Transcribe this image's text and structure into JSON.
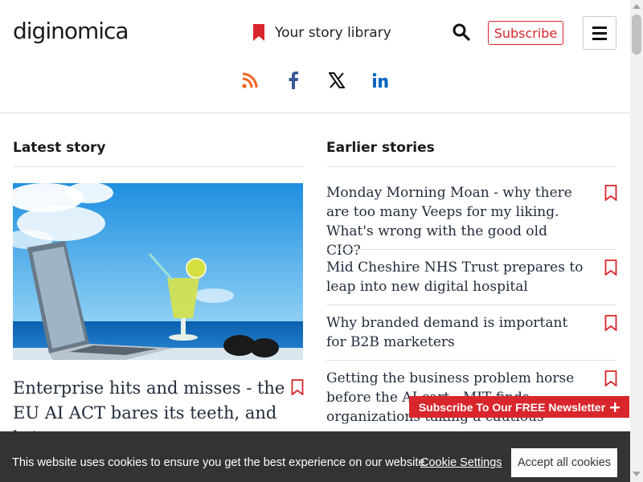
{
  "header": {
    "logo": "diginomica",
    "library_label": "Your story library",
    "subscribe_label": "Subscribe",
    "icons": [
      "bookmark-icon",
      "search-icon",
      "menu-icon"
    ],
    "social": [
      "rss-icon",
      "facebook-icon",
      "x-icon",
      "linkedin-icon"
    ]
  },
  "latest": {
    "title": "Latest story",
    "headline": "Enterprise hits and misses - the EU AI ACT bares its teeth, and bring on"
  },
  "earlier": {
    "title": "Earlier stories",
    "items": [
      {
        "headline": "Monday Morning Moan - why there are too many Veeps for my liking. What's wrong with the good old CIO?"
      },
      {
        "headline": "Mid Cheshire NHS Trust prepares to leap into new digital hospital"
      },
      {
        "headline": "Why branded demand is important for B2B marketers"
      },
      {
        "headline": "Getting the business problem horse before the AI cart - MIT finds organizations taking a cautious"
      }
    ]
  },
  "newsletter": {
    "label": "Subscribe To Our FREE Newsletter"
  },
  "cookie": {
    "text": "This website uses cookies to ensure you get the best experience on our website.",
    "settings_label": "Cookie Settings",
    "accept_label": "Accept all cookies"
  },
  "colors": {
    "brand_red": "#d9262c",
    "rss": "#f26522",
    "facebook": "#3b5998",
    "linkedin": "#0a66c2",
    "cookie_bg": "#333333"
  }
}
